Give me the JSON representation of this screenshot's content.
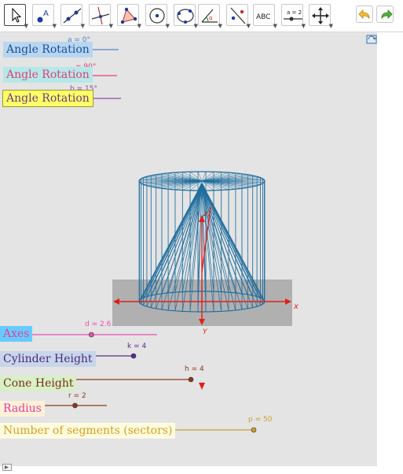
{
  "toolbar": {
    "tools": [
      {
        "icon": "move-pointer-icon",
        "selected": true
      },
      {
        "icon": "point-icon",
        "selected": false
      },
      {
        "icon": "line-through-two-points-icon",
        "selected": false
      },
      {
        "icon": "perpendicular-line-icon",
        "selected": false
      },
      {
        "icon": "polygon-icon",
        "selected": false
      },
      {
        "icon": "circle-with-center-icon",
        "selected": false
      },
      {
        "icon": "circle-through-three-points-icon",
        "selected": false
      },
      {
        "icon": "angle-icon",
        "selected": false
      },
      {
        "icon": "reflect-about-line-icon",
        "selected": false
      },
      {
        "icon": "text-icon",
        "selected": false
      },
      {
        "icon": "slider-icon",
        "selected": false
      },
      {
        "icon": "move-graphics-view-icon",
        "selected": false
      }
    ],
    "text_tool_label": "ABC",
    "slider_tool_label": "a = 2",
    "undo_icon": "undo-icon",
    "redo_icon": "redo-icon"
  },
  "graphics_view_icon": "graphics-view-settings-icon",
  "sliders": {
    "angle_a": {
      "label": "Angle Rotation",
      "value_text": "a = 0°",
      "value_deg": 0,
      "min": 0,
      "max": 360,
      "label_bg": "#b8d6f0",
      "label_color": "#1a4f9c",
      "line_color": "#5a7fcf"
    },
    "angle_b": {
      "label": "Angle Rotation",
      "value_text": "= 90°",
      "value_deg": 90,
      "min": 0,
      "max": 360,
      "label_bg": "#b5e8e8",
      "label_color": "#e0407a",
      "line_color": "#e0407a"
    },
    "angle_c": {
      "label": "Angle Rotation",
      "value_text": "b = 15°",
      "value_deg": 15,
      "min": 0,
      "max": 360,
      "label_bg": "#ffff66",
      "label_color": "#6b3a8a",
      "line_color": "#8a4fa6"
    },
    "axes": {
      "label": "Axes",
      "value_text": "d = 2.6",
      "value": 2.6,
      "label_bg": "#66ccff",
      "label_color": "#e0409a",
      "line_color": "#e84fb0"
    },
    "cylinder_height": {
      "label": "Cylinder Height",
      "value_text": "k = 4",
      "value": 4,
      "label_bg": "#c8d6ea",
      "label_color": "#4b2a7a",
      "line_color": "#5a2a8a"
    },
    "cone_height": {
      "label": "Cone Height",
      "value_text": "h = 4",
      "value": 4,
      "label_bg": "#d8f0c8",
      "label_color": "#7a3010",
      "line_color": "#8a3a1a"
    },
    "radius": {
      "label": "Radius",
      "value_text": "r = 2",
      "value": 2,
      "label_bg": "#fff0d8",
      "label_color": "#e040a0",
      "line_color": "#8a3a1a"
    },
    "segments": {
      "label": "Number of segments (sectors)",
      "value_text": "p = 50",
      "value": 50,
      "label_bg": "#fffbe0",
      "label_color": "#d4a020",
      "line_color": "#c8a030"
    }
  },
  "view3d": {
    "x_axis_label": "x",
    "y_axis_label": "Y",
    "z_axis_label": "z",
    "axis_color": "#e0201a",
    "mesh_color": "#1f6e9e",
    "plane_color": "#a7a7a7"
  },
  "bottom_corner_icon": "style-bar-toggle-icon"
}
